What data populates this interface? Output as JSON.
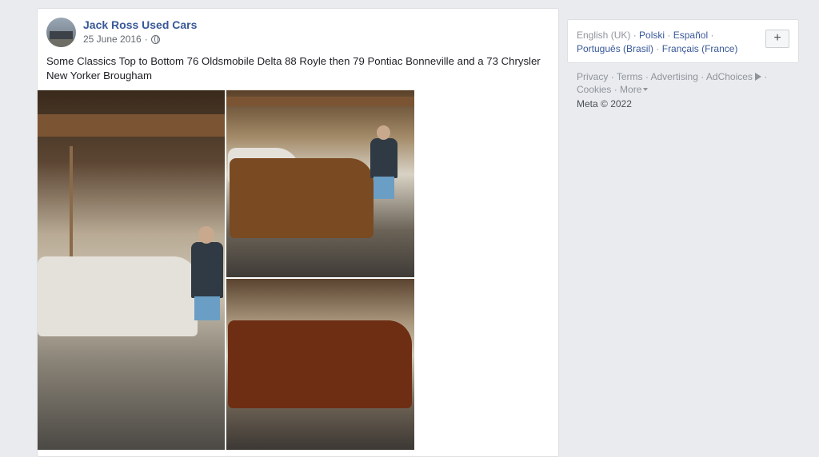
{
  "post": {
    "page_name": "Jack Ross Used Cars",
    "date": "25 June 2016",
    "date_separator": "·",
    "text": "Some Classics Top to Bottom 76 Oldsmobile Delta 88 Royle then 79 Pontiac Bonneville and a 73 Chrysler New Yorker Brougham"
  },
  "languages": {
    "current": "English (UK)",
    "items": [
      "Polski",
      "Español",
      "Português (Brasil)",
      "Français (France)"
    ],
    "separator": "·",
    "add_label": "+"
  },
  "footer": {
    "links": [
      "Privacy",
      "Terms",
      "Advertising",
      "AdChoices",
      "Cookies",
      "More"
    ],
    "separator": "·",
    "copyright": "Meta © 2022"
  },
  "colors": {
    "link": "#385898",
    "muted": "#90949c",
    "background": "#e9ebee"
  }
}
